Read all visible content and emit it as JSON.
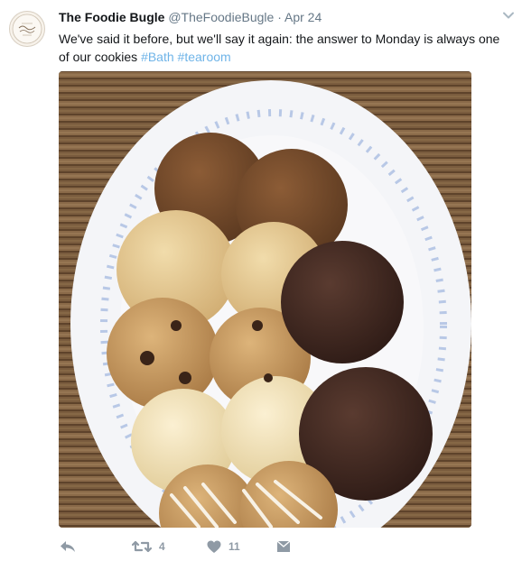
{
  "tweet": {
    "author_name": "The Foodie Bugle",
    "author_handle": "@TheFoodieBugle",
    "separator": "·",
    "date": "Apr 24",
    "text": "We've said it before, but we'll say it again: the answer to Monday is always one of our cookies ",
    "hashtags": [
      "#Bath",
      "#tearoom"
    ],
    "media_icon": "photo-of-cookies-on-plate",
    "avatar_icon": "foodie-bugle-logo",
    "retweet_count": "4",
    "like_count": "11"
  },
  "actions": {
    "reply_icon": "reply-icon",
    "retweet_icon": "retweet-icon",
    "like_icon": "heart-icon",
    "message_icon": "envelope-icon"
  },
  "colors": {
    "hashtag": "#6fb4e8",
    "action_gray": "#8f9aa5",
    "muted_text": "#657786"
  }
}
